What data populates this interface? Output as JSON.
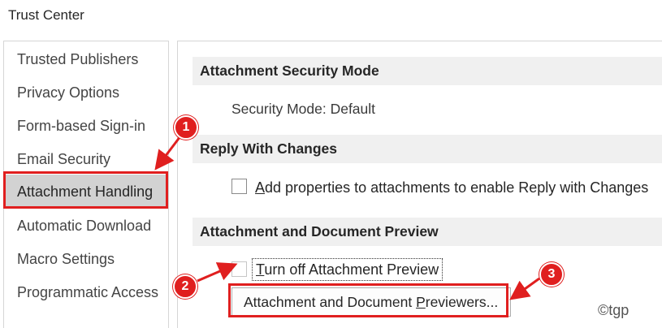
{
  "window": {
    "title": "Trust Center"
  },
  "sidebar": {
    "items": [
      {
        "label": "Trusted Publishers"
      },
      {
        "label": "Privacy Options"
      },
      {
        "label": "Form-based Sign-in"
      },
      {
        "label": "Email Security"
      },
      {
        "label": "Attachment Handling",
        "selected": true
      },
      {
        "label": "Automatic Download"
      },
      {
        "label": "Macro Settings"
      },
      {
        "label": "Programmatic Access"
      }
    ]
  },
  "sections": {
    "security_mode": {
      "header": "Attachment Security Mode",
      "text": "Security Mode: Default"
    },
    "reply": {
      "header": "Reply With Changes",
      "checkbox_label_access": "A",
      "checkbox_label_rest": "dd properties to attachments to enable Reply with Changes",
      "checked": false
    },
    "preview": {
      "header": "Attachment and Document Preview",
      "checkbox_label_access": "T",
      "checkbox_label_rest": "urn off Attachment Preview",
      "checked": false,
      "button_prefix": "Attachment and Document ",
      "button_access": "P",
      "button_suffix": "reviewers..."
    }
  },
  "annotations": {
    "markers": [
      "1",
      "2",
      "3"
    ],
    "color": "#e01f1f"
  },
  "watermark": "©tgp"
}
